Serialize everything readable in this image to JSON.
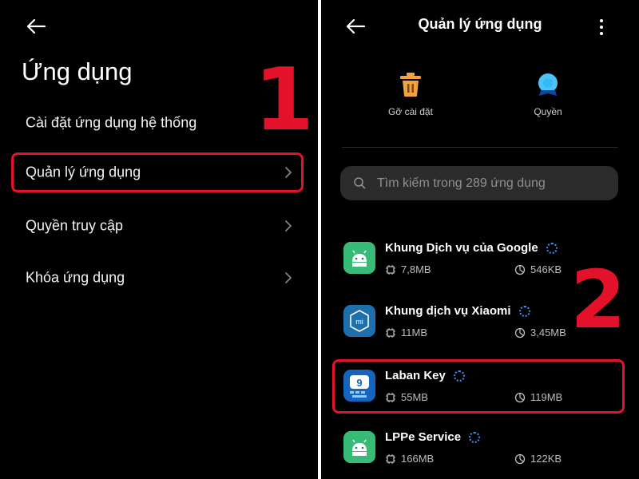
{
  "left": {
    "title": "Ứng dụng",
    "items": [
      {
        "label": "Cài đặt ứng dụng hệ thống",
        "chevron": false
      },
      {
        "label": "Quản lý ứng dụng",
        "chevron": true,
        "highlighted": true
      },
      {
        "label": "Quyền truy cập",
        "chevron": true
      },
      {
        "label": "Khóa ứng dụng",
        "chevron": true
      }
    ],
    "step": "1"
  },
  "right": {
    "title": "Quản lý ứng dụng",
    "actions": [
      {
        "label": "Gỡ cài đặt",
        "icon": "trash-icon",
        "color": "#f6a23a"
      },
      {
        "label": "Quyền",
        "icon": "shield-icon",
        "color": "#4fc3f7"
      }
    ],
    "search": {
      "placeholder": "Tìm kiếm trong 289 ứng dụng"
    },
    "apps": [
      {
        "name": "Khung Dịch vụ của Google",
        "storage": "7,8MB",
        "cache": "546KB",
        "icon": "android-icon"
      },
      {
        "name": "Khung dịch vụ Xiaomi",
        "storage": "11MB",
        "cache": "3,45MB",
        "icon": "mi-icon"
      },
      {
        "name": "Laban Key",
        "storage": "55MB",
        "cache": "119MB",
        "icon": "laban-key-icon",
        "highlighted": true
      },
      {
        "name": "LPPe Service",
        "storage": "166MB",
        "cache": "122KB",
        "icon": "android-icon"
      }
    ],
    "step": "2"
  },
  "colors": {
    "highlight": "#e3122a",
    "accent": "#3b8ff2",
    "background": "#000000"
  }
}
